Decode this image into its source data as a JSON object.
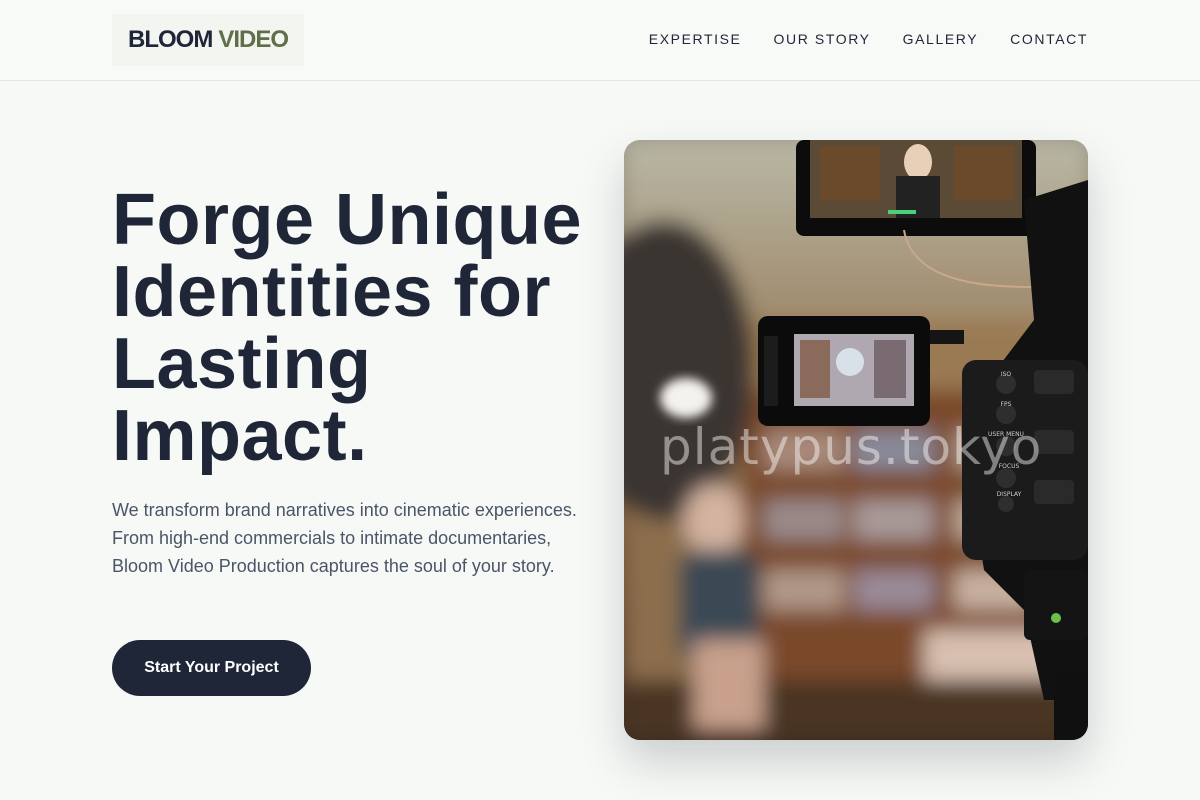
{
  "header": {
    "logo_brand": "BLOOM",
    "logo_accent": "VIDEO",
    "nav": [
      "EXPERTISE",
      "OUR STORY",
      "GALLERY",
      "CONTACT"
    ]
  },
  "hero": {
    "title_lines": [
      "Forge Unique",
      "Identities for",
      "Lasting",
      "Impact."
    ],
    "copy": "We transform brand narratives into cinematic experiences. From high-end commercials to intimate documentaries, Bloom Video Production captures the soul of your story.",
    "cta_label": "Start Your Project"
  },
  "image": {
    "watermark": "platypus.tokyo",
    "camera_labels": [
      "ISO",
      "FPS",
      "USER MENU",
      "FOCUS",
      "DISPLAY"
    ]
  },
  "colors": {
    "primary": "#1e2638",
    "accent": "#5f6f4a",
    "background": "#f7f9f6",
    "body_text": "#4a5568"
  }
}
